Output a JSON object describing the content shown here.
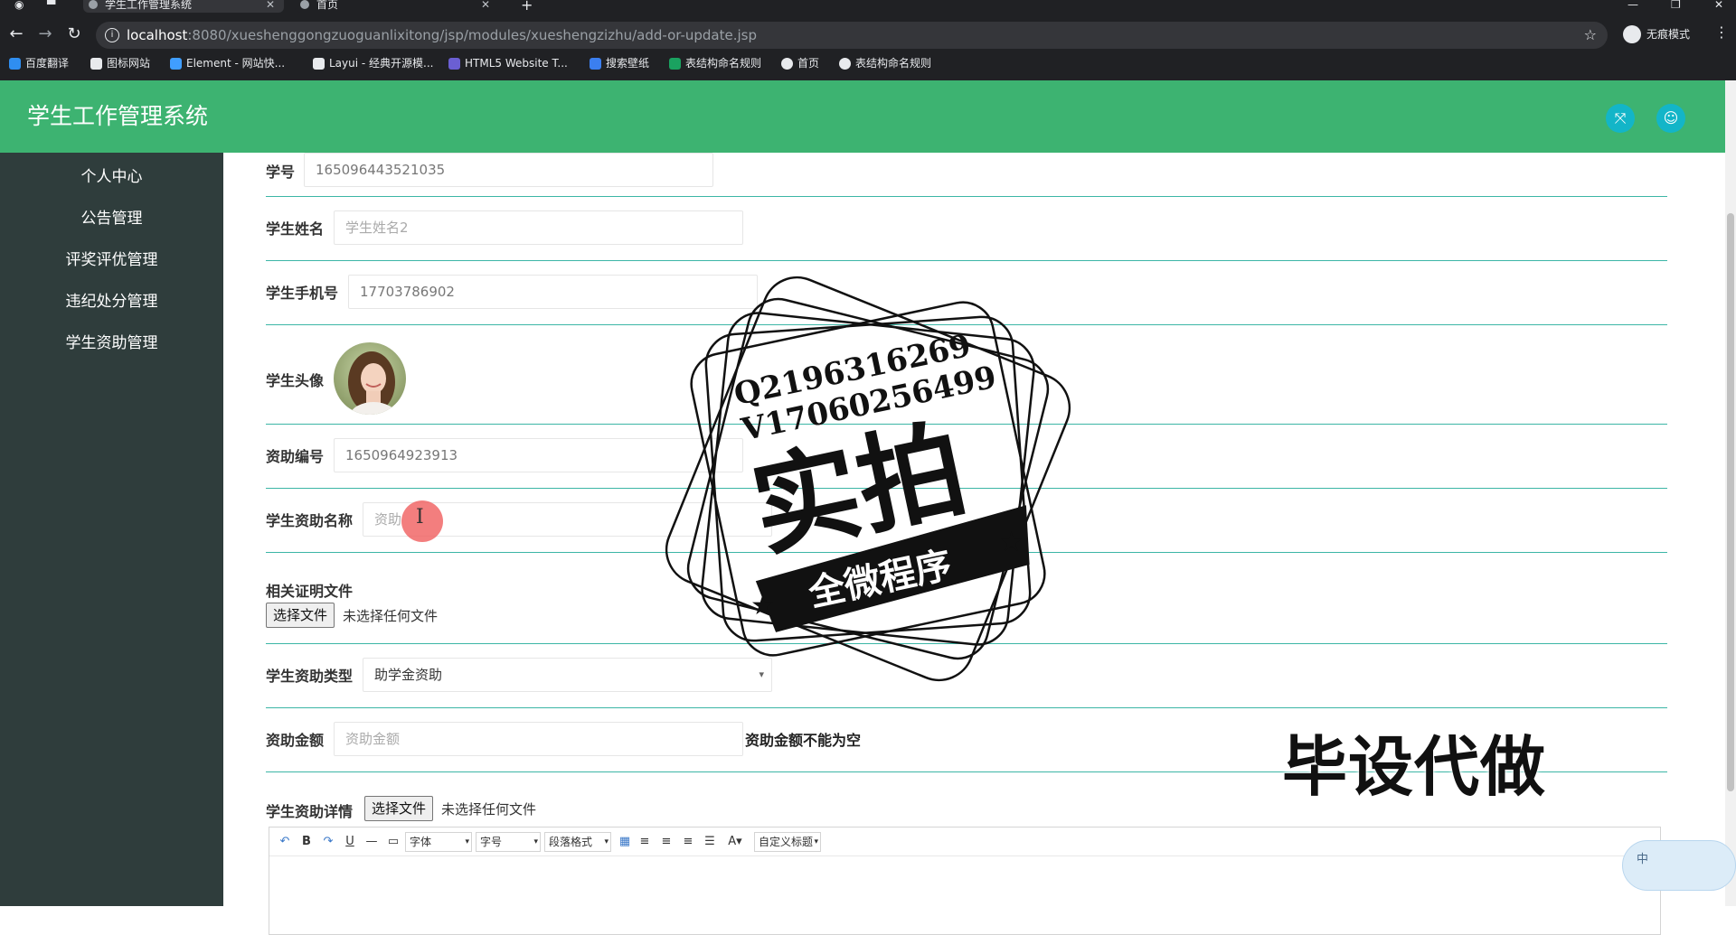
{
  "browser": {
    "tabs": [
      {
        "title": "学生工作管理系统",
        "active": true
      },
      {
        "title": "首页",
        "active": false
      }
    ],
    "url_host": "localhost",
    "url_path": ":8080/xueshenggongzuoguanlixitong/jsp/modules/xueshengzizhu/add-or-update.jsp",
    "incognito_label": "无痕模式",
    "bookmarks": [
      {
        "label": "百度翻译",
        "color": "#2f8ef0"
      },
      {
        "label": "图标网站",
        "color": "#e8eaed"
      },
      {
        "label": "Element - 网站快...",
        "color": "#409eff"
      },
      {
        "label": "Layui - 经典开源模...",
        "color": "#e8eaed"
      },
      {
        "label": "HTML5 Website T...",
        "color": "#6b5fd3"
      },
      {
        "label": "搜索壁纸",
        "color": "#3b7ff0"
      },
      {
        "label": "表结构命名规则",
        "color": "#1aa260"
      },
      {
        "label": "首页",
        "color": "#e8eaed"
      },
      {
        "label": "表结构命名规则",
        "color": "#e8eaed"
      }
    ]
  },
  "app": {
    "title": "学生工作管理系统",
    "header_color": "#3db371",
    "sidebar_color": "#2f3d3c",
    "accent_color": "#13b5c8"
  },
  "sidebar": {
    "items": [
      {
        "label": "个人中心"
      },
      {
        "label": "公告管理"
      },
      {
        "label": "评奖评优管理"
      },
      {
        "label": "违纪处分管理"
      },
      {
        "label": "学生资助管理"
      }
    ]
  },
  "form": {
    "student_no": {
      "label": "学号",
      "value": "165096443521035"
    },
    "student_name": {
      "label": "学生姓名",
      "placeholder": "学生姓名2"
    },
    "student_phone": {
      "label": "学生手机号",
      "value": "17703786902"
    },
    "student_avatar": {
      "label": "学生头像"
    },
    "aid_no": {
      "label": "资助编号",
      "value": "1650964923913"
    },
    "aid_name": {
      "label": "学生资助名称",
      "placeholder": "资助"
    },
    "proof_file": {
      "label": "相关证明文件",
      "button": "选择文件",
      "status": "未选择任何文件"
    },
    "aid_type": {
      "label": "学生资助类型",
      "selected": "助学金资助"
    },
    "aid_amount": {
      "label": "资助金额",
      "placeholder": "资助金额",
      "error": "资助金额不能为空"
    },
    "aid_detail": {
      "label": "学生资助详情",
      "button": "选择文件",
      "status": "未选择任何文件"
    }
  },
  "editor": {
    "font_select": "字体",
    "size_select": "字号",
    "paragraph_select": "段落格式",
    "custom_title": "自定义标题"
  },
  "overlays": {
    "stamp_qq": "Q2196316269",
    "stamp_vx": "V17060256499",
    "stamp_main": "实拍",
    "stamp_banner": "全微程序",
    "promo": "毕设代做",
    "ime": "中"
  }
}
